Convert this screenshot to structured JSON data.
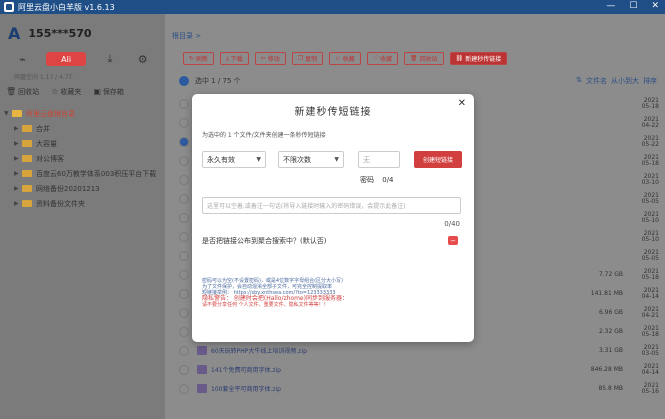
{
  "window": {
    "title": "阿里云盘小白羊版 v1.6.13",
    "controls": [
      "—",
      "☐",
      "✕"
    ]
  },
  "sidebar": {
    "brand": "A",
    "username": "155***570",
    "tabs": [
      {
        "icon": "rss-icon",
        "glyph": "⌁"
      },
      {
        "label": "Ali",
        "active": true
      },
      {
        "icon": "download-icon",
        "glyph": "⤓"
      },
      {
        "icon": "gear-icon",
        "glyph": "⚙"
      }
    ],
    "storage": "网盘空间 1.17 / 4.7T",
    "quick": [
      "回收站",
      "收藏夹",
      "保存箱"
    ],
    "root": "阿里云盘根目录",
    "folders": [
      "合并",
      "大容量",
      "对公博客",
      "百度云60万教学体系003积压平台下载",
      "网络备份20201213",
      "资料备份文件夹"
    ]
  },
  "main": {
    "breadcrumb": "根目录 >",
    "toolbar": [
      "刷新",
      "下载",
      "移动",
      "复制",
      "收藏",
      "收藏",
      "回收站",
      "新建秒传链接"
    ],
    "list_header": {
      "selected": "选中 1 / 75 个",
      "sort_name": "文件名",
      "sort_size": "从小到大",
      "sort_type": "排序"
    },
    "rows": [
      {
        "name": "",
        "size": "",
        "date": "2021\n05-18"
      },
      {
        "name": "",
        "size": "",
        "date": "2021\n04-22"
      },
      {
        "name": "",
        "size": "",
        "date": "2021\n05-22"
      },
      {
        "name": "",
        "size": "",
        "date": "2021\n05-18"
      },
      {
        "name": "",
        "size": "",
        "date": "2021\n03-10"
      },
      {
        "name": "",
        "size": "",
        "date": "2021\n05-05"
      },
      {
        "name": "",
        "size": "",
        "date": "2021\n05-10"
      },
      {
        "name": "",
        "size": "",
        "date": "2021\n05-10"
      },
      {
        "name": "",
        "size": "",
        "date": "2021\n05-05"
      },
      {
        "name": "",
        "size": "7.72 GB",
        "date": "2021\n05-18"
      },
      {
        "name": "",
        "size": "141.81 MB",
        "date": "2021\n04-14"
      },
      {
        "name": "",
        "size": "6.96 GB",
        "date": "2021\n04-21"
      },
      {
        "name": "",
        "size": "2.32 GB",
        "date": "2021\n05-18"
      },
      {
        "name": "60天玩转PHP大牛线上培训视频.zip",
        "size": "3.31 GB",
        "date": "2021\n03-05"
      },
      {
        "name": "141个免费可商用字体.zip",
        "size": "846.28 MB",
        "date": "2021\n04-14"
      },
      {
        "name": "100套全平可商用字体.zip",
        "size": "85.8 MB",
        "date": "2021\n05-16"
      }
    ]
  },
  "modal": {
    "title": "新建秒传短链接",
    "description": "为选中的 1 个文件/文件夹创建一条秒传短链接",
    "validity": "永久有效",
    "times": "不限次数",
    "password_placeholder": "无",
    "create_label": "创建短链接",
    "password_label": "密码",
    "password_count": "0/4",
    "note_placeholder": "这里可以空着,或备注一句话(将导入链接时输入的密码错误，会提示此备注)",
    "note_count": "0/40",
    "public_question": "是否把链接公布到聚合搜索中？(默认否)",
    "tips": [
      "密码可以为空(不设置密码)，或是4位数字字母组合(区分大小写)",
      "为了文件保护，会自动混淆全部子文件，可完全控制提取率",
      "短链接举例： https://sby.xnthsea.com/?to=123333333",
      "隐私警告：  创建时会把(Hallo/zhome)同步到服务器：",
      "请不要分享任何  个人文件、重要文件、隐私文件等等！！"
    ]
  }
}
